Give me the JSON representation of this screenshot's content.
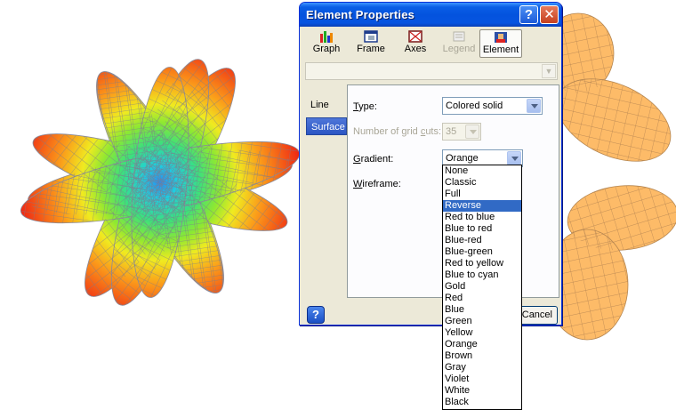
{
  "dialog": {
    "title": "Element Properties",
    "help_glyph": "?",
    "close_glyph": "✕"
  },
  "toolbar": {
    "graph": "Graph",
    "frame": "Frame",
    "axes": "Axes",
    "legend": "Legend",
    "element": "Element"
  },
  "tabs": {
    "line": "Line",
    "surface": "Surface"
  },
  "form": {
    "type_label_u": "T",
    "type_label_rest": "ype:",
    "type_value": "Colored solid",
    "gridcuts_label_a": "Number of grid ",
    "gridcuts_label_u": "c",
    "gridcuts_label_b": "uts:",
    "gridcuts_value": "35",
    "gradient_label_u": "G",
    "gradient_label_rest": "radient:",
    "gradient_value": "Orange",
    "wireframe_label_u": "W",
    "wireframe_label_rest": "ireframe:"
  },
  "buttons": {
    "cancel": "Cancel",
    "help": "?"
  },
  "gradient_options": [
    "None",
    "Classic",
    "Full",
    "Reverse",
    "Red to blue",
    "Blue to red",
    "Blue-red",
    "Blue-green",
    "Red to yellow",
    "Blue to cyan",
    "Gold",
    "Red",
    "Blue",
    "Green",
    "Yellow",
    "Orange",
    "Brown",
    "Gray",
    "Violet",
    "White",
    "Black"
  ],
  "highlighted_option": "Reverse",
  "colors": {
    "titlebar": "#0453de",
    "highlight": "#316ac5",
    "orange_surface": "#fdbb68",
    "mesh_line": "#8a8a9a"
  }
}
